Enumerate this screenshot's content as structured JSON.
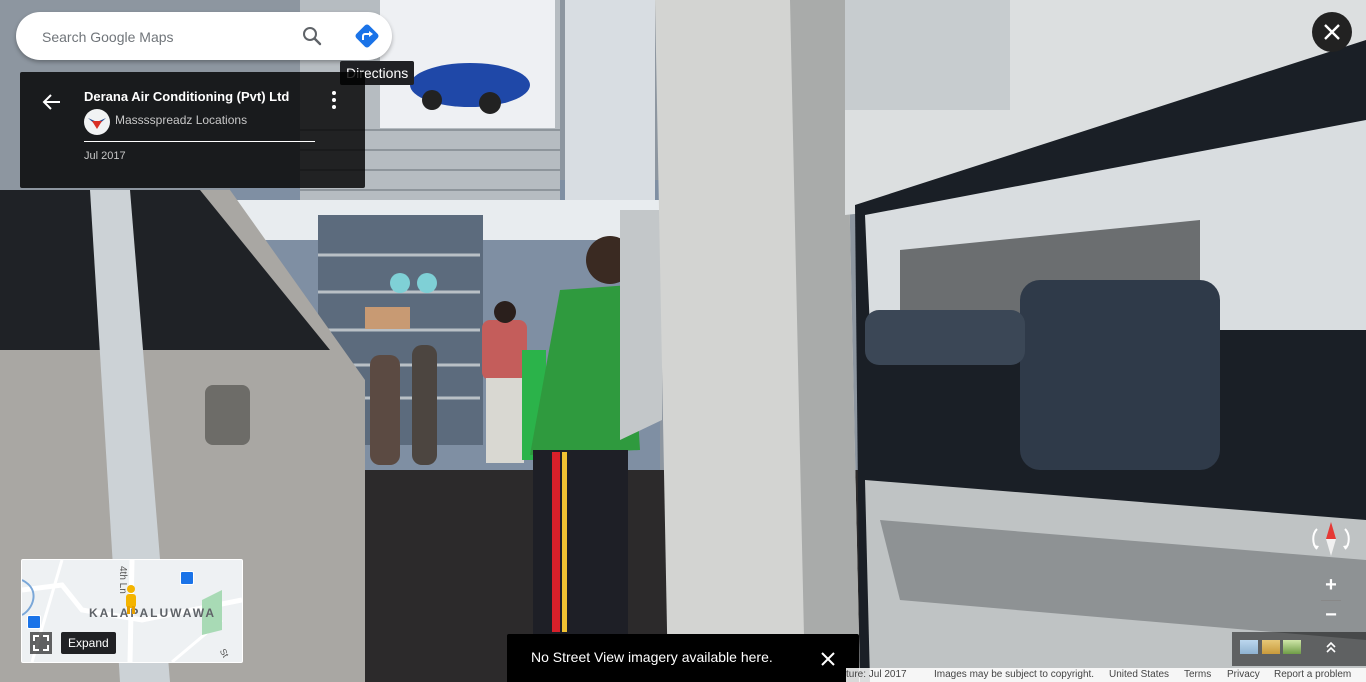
{
  "search": {
    "placeholder": "Search Google Maps"
  },
  "icons": {
    "search": "search-icon",
    "directions": "directions-icon",
    "back": "arrow-back-icon",
    "more": "more-vert-icon",
    "close": "close-icon",
    "expand": "fullscreen-icon",
    "compass": "compass-icon",
    "transit": "bus-stop-icon",
    "pegman": "pegman-icon"
  },
  "tooltips": {
    "directions": "Directions",
    "expand": "Expand"
  },
  "place": {
    "name": "Derana Air Conditioning (Pvt) Ltd",
    "author": "Masssspreadz Locations",
    "date": "Jul 2017"
  },
  "minimap": {
    "area_label": "KALAPALUWAWA",
    "road_label": "4th Ln",
    "road_label_2": "St"
  },
  "toast": {
    "message": "No Street View imagery available here."
  },
  "footer": {
    "capture": "ture: Jul 2017",
    "copyright": "Images may be subject to copyright.",
    "region": "United States",
    "terms": "Terms",
    "privacy": "Privacy",
    "report": "Report a problem"
  },
  "colors": {
    "accent_blue": "#1a73e8",
    "compass_red": "#e53935",
    "toast_bg": "#000000"
  }
}
